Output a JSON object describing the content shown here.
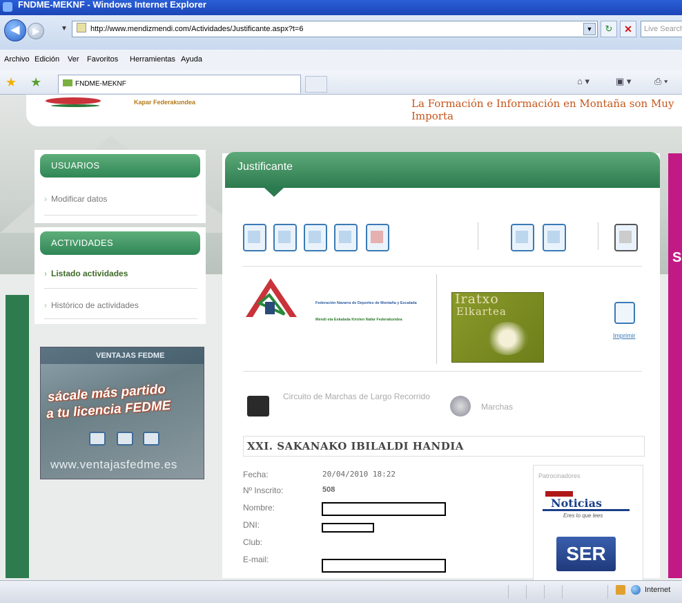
{
  "window": {
    "title": "FNDME-MEKNF - Windows Internet Explorer"
  },
  "address_bar": {
    "url": "http://www.mendizmendi.com/Actividades/Justificante.aspx?t=6",
    "search_placeholder": "Live Search"
  },
  "menu": {
    "items": [
      "Archivo",
      "Edición",
      "Ver",
      "Favoritos",
      "Herramientas",
      "Ayuda"
    ]
  },
  "tab": {
    "label": "FNDME-MEKNF"
  },
  "site_header": {
    "org_name_basque": "Kapar Federakundea",
    "slogan": "La Formación e Información en Montaña son Muy Importa"
  },
  "sidebar": {
    "usuarios_title": "USUARIOS",
    "usuarios_items": [
      "Modificar datos"
    ],
    "actividades_title": "ACTIVIDADES",
    "actividades_items": [
      "Listado actividades",
      "Histórico de actividades"
    ],
    "banner": {
      "top_text": "VENTAJAS FEDME",
      "line1": "sácale más partido",
      "line2": "a tu licencia FEDME",
      "url": "www.ventajasfedme.es"
    }
  },
  "main": {
    "title": "Justificante",
    "federation": {
      "name_es": "Federación Navarra de Deportes de Montaña y Escalada",
      "name_eu": "Mendi eta Eskalada Kirolen Nafar Federakundea"
    },
    "iratxo_text_1": "Iratxo",
    "iratxo_text_2": "Elkartea",
    "print_label": "Imprimir",
    "circuit_label": "Circuito de Marchas de Largo Recorrido",
    "marchas_label": "Marchas",
    "event_title": "XXI. SAKANAKO IBILALDI HANDIA",
    "fields": {
      "fecha_label": "Fecha:",
      "fecha_value": "20/04/2010 18:22",
      "inscrito_label": "Nº Inscrito:",
      "inscrito_value": "508",
      "nombre_label": "Nombre:",
      "dni_label": "DNI:",
      "club_label": "Club:",
      "email_label": "E-mail:"
    },
    "sponsors": {
      "label": "Patrocinadores",
      "noticias": "Noticias",
      "noticias_tagline": "Eres lo que lees",
      "ser": "SER"
    }
  },
  "statusbar": {
    "zone": "Internet"
  },
  "colors": {
    "green_header": "#2c7a4f",
    "magenta_strip": "#c21a84",
    "slogan": "#c3551a"
  }
}
